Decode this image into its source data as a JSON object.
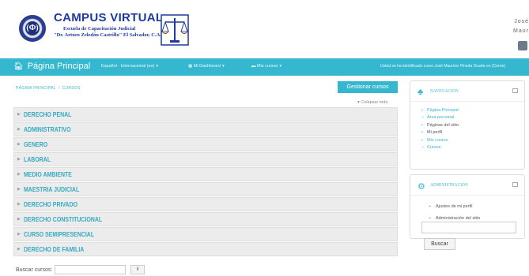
{
  "header": {
    "site_title": "CAMPUS VIRTUAL",
    "school_line1": "Escuela de Capacitación Judicial",
    "school_line2": "\"Dr. Arturo Zeledón Castrillo\" El Salvador, C.A.",
    "logo_mark": "(Ф)",
    "user_first": "José",
    "user_last": "Mauricio"
  },
  "navbar": {
    "home_label": "Página Principal",
    "language": "Español - Internacional (es)",
    "dashboard": "Mi Dashboard",
    "my_courses": "Mis cursos",
    "login_text": "Usted se ha identificado como José Mauricio Pineda Duarte en (Cerrar)"
  },
  "breadcrumb": {
    "home": "PÁGINA PRINCIPAL",
    "separator": "/",
    "current": "CURSOS"
  },
  "main": {
    "manage_button": "Gestionar cursos",
    "collapse_all": "Colapsar todo",
    "categories": [
      "DERECHO PENAL",
      "ADMINISTRATIVO",
      "GENERO",
      "LABORAL",
      "MEDIO AMBIENTE",
      "MAESTRIA JUDICIAL",
      "DERECHO PRIVADO",
      "DERECHO CONSTITUCIONAL",
      "CURSO SEMIPRESENCIAL",
      "DERECHO DE FAMILIA"
    ],
    "search_label": "Buscar cursos:",
    "search_go": "Ir"
  },
  "navigation_block": {
    "title": "NAVEGACIÓN",
    "items": [
      "Página Principal",
      "Área personal",
      "Páginas del sitio",
      "Mi perfil",
      "Mis cursos",
      "Cursos"
    ]
  },
  "admin_block": {
    "title": "ADMINISTRACIÓN",
    "items": [
      "Ajustes de mi perfil",
      "Administración del sitio"
    ],
    "search_button": "Buscar"
  },
  "colors": {
    "accent": "#35b8cf",
    "brand_blue": "#1d3aa0",
    "category_bg": "#ececec"
  }
}
